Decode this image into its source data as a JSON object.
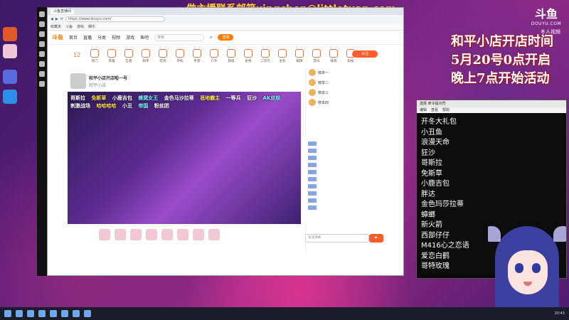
{
  "overlay": {
    "top_contact": "做主播联系邮箱xingchen@littletuan.com",
    "promo_lines": [
      "和平小店开店时间",
      "5月20号0点开启",
      "晚上7点开始活动"
    ]
  },
  "brand": {
    "douyu_logo": "斗鱼",
    "douyu_domain": "DOUYU.COM",
    "douyu_sub": "冬人视频"
  },
  "browser": {
    "tab_title": "斗鱼直播间",
    "url": "https://www.douyu.com/",
    "bookmarks": [
      "收藏夹",
      "斗鱼",
      "游戏",
      "娱乐"
    ],
    "site_logo": "斗鱼",
    "nav": [
      "首页",
      "直播",
      "分类",
      "视频",
      "游戏",
      "鱼吧"
    ],
    "search_placeholder": "搜索",
    "login_label": "登录",
    "follow_count": "12",
    "follow_label": "关注",
    "categories": [
      "热门",
      "英雄",
      "王者",
      "和平",
      "吃鸡",
      "单机",
      "手游",
      "户外",
      "颜值",
      "星秀",
      "二次元",
      "主机",
      "棋牌",
      "音乐",
      "体育",
      "科技",
      "数码",
      "文化"
    ],
    "room_title": "和平小店开店啦一号",
    "streamer": "和平小店",
    "danmaku": [
      "哥斯拉",
      "免斯草",
      "小鹿吉包",
      "蜂窝女王",
      "金色马沙拉蒂",
      "恶地霸主",
      "一等兵",
      "狂沙",
      "AK皮肤",
      "刺激战场",
      "哈哈哈哈",
      "小丑",
      "帝国",
      "粉丝团"
    ],
    "ranks": [
      "榜单一",
      "榜单二",
      "榜单三",
      "榜单四"
    ],
    "chat_placeholder": "发送弹幕"
  },
  "console": {
    "title": "选择 命令提示符",
    "menu": [
      "编辑",
      "查看",
      "帮助"
    ],
    "items": [
      "开冬大礼包",
      "小丑鱼",
      "浪漫天命",
      "狂沙",
      "哥斯拉",
      "免斯草",
      "小鹿吉包",
      "胖达",
      "金色玛莎拉蒂",
      "蟑螂",
      "新火箭",
      "西部仔仔",
      "M416心之恋语",
      "爱恋白鹤",
      "哥特玫瑰"
    ]
  },
  "taskbar": {
    "clock": "20:43"
  }
}
